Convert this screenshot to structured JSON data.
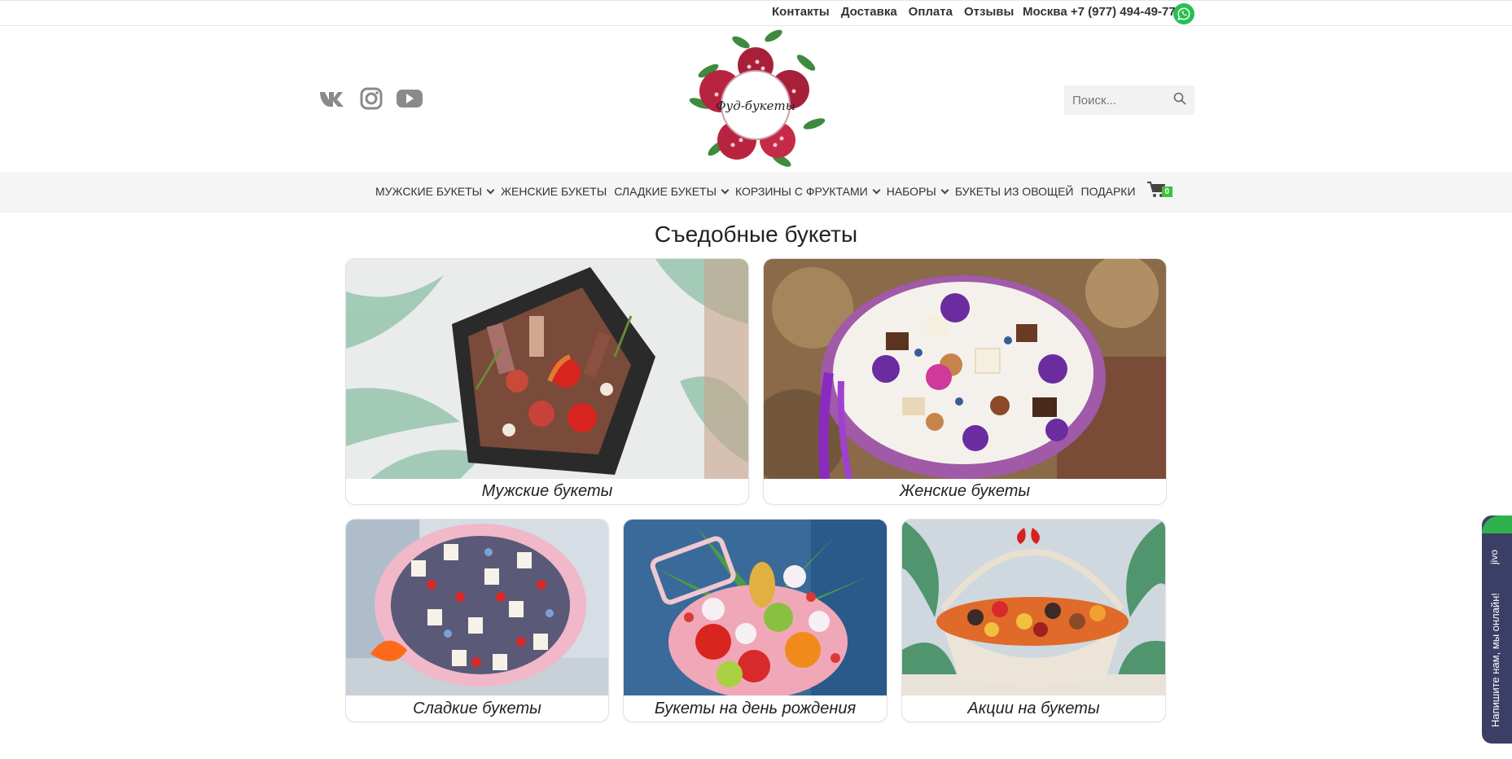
{
  "top": {
    "links": [
      "Контакты",
      "Доставка",
      "Оплата",
      "Отзывы"
    ],
    "city_phone": "Москва +7 (977) 494-49-77"
  },
  "logo_text": "Фуд-букеты",
  "socials": [
    "vk-icon",
    "instagram-icon",
    "youtube-icon"
  ],
  "search": {
    "placeholder": "Поиск..."
  },
  "nav": {
    "items": [
      {
        "label": "МУЖСКИЕ БУКЕТЫ",
        "dropdown": true
      },
      {
        "label": "ЖЕНСКИЕ БУКЕТЫ",
        "dropdown": false
      },
      {
        "label": "СЛАДКИЕ БУКЕТЫ",
        "dropdown": true
      },
      {
        "label": "КОРЗИНЫ С ФРУКТАМИ",
        "dropdown": true
      },
      {
        "label": "НАБОРЫ",
        "dropdown": true
      },
      {
        "label": "БУКЕТЫ ИЗ ОВОЩЕЙ",
        "dropdown": false
      },
      {
        "label": "ПОДАРКИ",
        "dropdown": false
      }
    ],
    "cart_count": "0"
  },
  "page_title": "Съедобные букеты",
  "categories": [
    {
      "label": "Мужские букеты"
    },
    {
      "label": "Женские букеты"
    },
    {
      "label": "Сладкие букеты"
    },
    {
      "label": "Букеты на день рождения"
    },
    {
      "label": "Акции на букеты"
    }
  ],
  "chat": {
    "brand": "jivo",
    "message": "Напишите нам, мы онлайн!"
  },
  "colors": {
    "whatsapp": "#25c052",
    "cart_badge": "#3ac33a",
    "chat_bg": "#3b3f66",
    "logo_red": "#b8243f"
  }
}
